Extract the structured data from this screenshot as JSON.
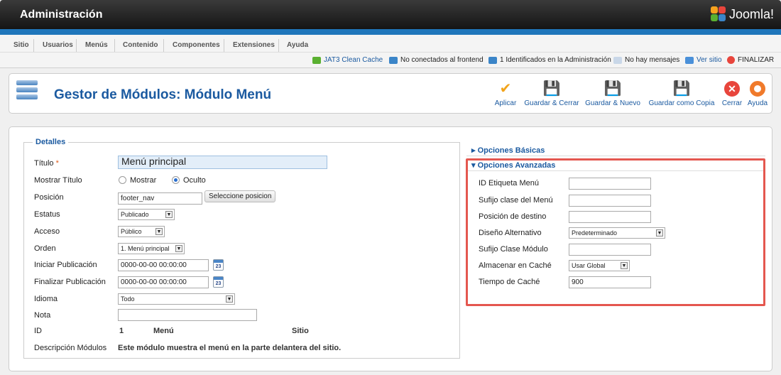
{
  "header": {
    "title": "Administración",
    "logo_text": "Joomla!"
  },
  "menu": [
    "Sitio",
    "Usuarios",
    "Menús",
    "Contenido",
    "Componentes",
    "Extensiones",
    "Ayuda"
  ],
  "status": {
    "clean_cache": "JAT3 Clean Cache",
    "frontend": "No conectados al frontend",
    "admin": "1 Identificados en la Administración",
    "messages": "No hay mensajes",
    "view_site": "Ver sitio",
    "logout": "FINALIZAR"
  },
  "page": {
    "title": "Gestor de Módulos: Módulo Menú"
  },
  "toolbar": {
    "apply": "Aplicar",
    "save_close": "Guardar & Cerrar",
    "save_new": "Guardar & Nuevo",
    "save_copy": "Guardar como Copia",
    "close": "Cerrar",
    "help": "Ayuda"
  },
  "details": {
    "legend": "Detalles",
    "titulo_label": "Título",
    "titulo_required": "*",
    "titulo_value": "Menú principal",
    "mostrar_titulo_label": "Mostrar Título",
    "mostrar_option": "Mostrar",
    "oculto_option": "Oculto",
    "posicion_label": "Posición",
    "posicion_value": "footer_nav",
    "posicion_button": "Seleccione posicion",
    "estatus_label": "Estatus",
    "estatus_value": "Publicado",
    "acceso_label": "Acceso",
    "acceso_value": "Público",
    "orden_label": "Orden",
    "orden_value": "1. Menú principal",
    "iniciar_label": "Iniciar Publicación",
    "iniciar_value": "0000-00-00 00:00:00",
    "finalizar_label": "Finalizar Publicación",
    "finalizar_value": "0000-00-00 00:00:00",
    "calendar_day": "23",
    "idioma_label": "Idioma",
    "idioma_value": "Todo",
    "nota_label": "Nota",
    "nota_value": "",
    "id_label": "ID",
    "id_value": "1",
    "id_type": "Menú",
    "id_client": "Sitio",
    "descripcion_label": "Descripción Módulos",
    "descripcion_value": "Este módulo muestra el menú en la parte delantera del sitio."
  },
  "basic_options": {
    "title": "Opciones Básicas"
  },
  "advanced_options": {
    "title": "Opciones Avanzadas",
    "id_etiqueta_label": "ID Etiqueta Menú",
    "id_etiqueta_value": "",
    "sufijo_menu_label": "Sufijo clase del Menú",
    "sufijo_menu_value": "",
    "posicion_destino_label": "Posición de destino",
    "posicion_destino_value": "",
    "diseno_label": "Diseño Alternativo",
    "diseno_value": "Predeterminado",
    "sufijo_modulo_label": "Sufijo Clase Módulo",
    "sufijo_modulo_value": "",
    "cache_label": "Almacenar en Caché",
    "cache_value": "Usar Global",
    "tiempo_label": "Tiempo de Caché",
    "tiempo_value": "900"
  }
}
